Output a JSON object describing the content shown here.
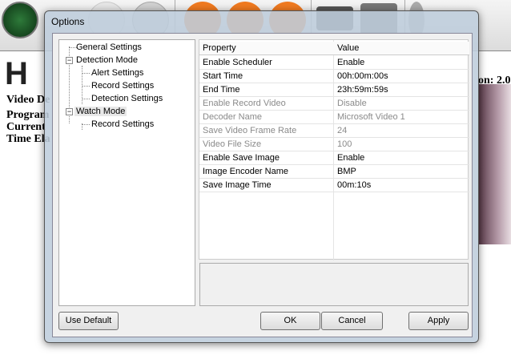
{
  "background": {
    "texts": [
      "Video De",
      "Program",
      "Current",
      "Time Ela"
    ],
    "version": "on: 2.0",
    "logo": "H"
  },
  "dialog": {
    "title": "Options",
    "tree": [
      {
        "label": "General Settings",
        "level": 0
      },
      {
        "label": "Detection Mode",
        "level": 0,
        "expanded": true
      },
      {
        "label": "Alert Settings",
        "level": 1
      },
      {
        "label": "Record Settings",
        "level": 1
      },
      {
        "label": "Detection Settings",
        "level": 1
      },
      {
        "label": "Watch Mode",
        "level": 0,
        "expanded": true,
        "selected": true
      },
      {
        "label": "Record Settings",
        "level": 1
      }
    ],
    "grid": {
      "headers": [
        "Property",
        "Value"
      ],
      "rows": [
        {
          "property": "Enable Scheduler",
          "value": "Enable",
          "enabled": true
        },
        {
          "property": "Start Time",
          "value": "00h:00m:00s",
          "enabled": true
        },
        {
          "property": "End Time",
          "value": "23h:59m:59s",
          "enabled": true
        },
        {
          "property": "Enable Record Video",
          "value": "Disable",
          "enabled": false
        },
        {
          "property": "Decoder Name",
          "value": "Microsoft Video 1",
          "enabled": false
        },
        {
          "property": "Save Video Frame Rate",
          "value": "24",
          "enabled": false
        },
        {
          "property": "Video File Size",
          "value": "100",
          "enabled": false
        },
        {
          "property": "Enable Save Image",
          "value": "Enable",
          "enabled": true
        },
        {
          "property": "Image Encoder Name",
          "value": "BMP",
          "enabled": true
        },
        {
          "property": "Save Image Time",
          "value": "00m:10s",
          "enabled": true
        }
      ]
    },
    "buttons": {
      "use_default": "Use Default",
      "ok": "OK",
      "cancel": "Cancel",
      "apply": "Apply"
    }
  }
}
